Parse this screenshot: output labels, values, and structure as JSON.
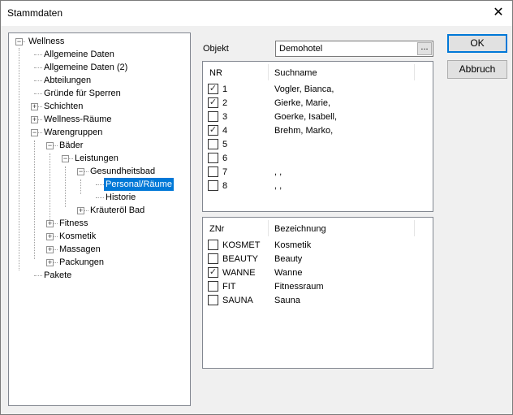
{
  "window": {
    "title": "Stammdaten",
    "close_glyph": "✕"
  },
  "tree": {
    "items": [
      {
        "label": "Wellness",
        "expander": "−"
      },
      {
        "label": "Allgemeine Daten"
      },
      {
        "label": "Allgemeine Daten (2)"
      },
      {
        "label": "Abteilungen"
      },
      {
        "label": "Gründe für Sperren"
      },
      {
        "label": "Schichten",
        "expander": "+"
      },
      {
        "label": "Wellness-Räume",
        "expander": "+"
      },
      {
        "label": "Warengruppen",
        "expander": "−"
      },
      {
        "label": "Bäder",
        "expander": "−"
      },
      {
        "label": "Leistungen",
        "expander": "−"
      },
      {
        "label": "Gesundheitsbad",
        "expander": "−"
      },
      {
        "label": "Personal/Räume",
        "selected": true
      },
      {
        "label": "Historie"
      },
      {
        "label": "Kräuteröl Bad",
        "expander": "+"
      },
      {
        "label": "Fitness",
        "expander": "+"
      },
      {
        "label": "Kosmetik",
        "expander": "+"
      },
      {
        "label": "Massagen",
        "expander": "+"
      },
      {
        "label": "Packungen",
        "expander": "+"
      },
      {
        "label": "Pakete"
      }
    ]
  },
  "object": {
    "label": "Objekt",
    "value": "Demohotel",
    "browse_label": "..."
  },
  "persons": {
    "columns": [
      "NR",
      "Suchname"
    ],
    "rows": [
      {
        "nr": "1",
        "name": "Vogler, Bianca,",
        "checked": true
      },
      {
        "nr": "2",
        "name": "Gierke, Marie,",
        "checked": true
      },
      {
        "nr": "3",
        "name": "Goerke, Isabell,",
        "checked": false
      },
      {
        "nr": "4",
        "name": "Brehm, Marko,",
        "checked": true
      },
      {
        "nr": "5",
        "name": "",
        "checked": false
      },
      {
        "nr": "6",
        "name": "",
        "checked": false
      },
      {
        "nr": "7",
        "name": ", ,",
        "checked": false
      },
      {
        "nr": "8",
        "name": ", ,",
        "checked": false
      }
    ]
  },
  "rooms": {
    "columns": [
      "ZNr",
      "Bezeichnung"
    ],
    "rows": [
      {
        "code": "KOSMET",
        "name": "Kosmetik",
        "checked": false
      },
      {
        "code": "BEAUTY",
        "name": "Beauty",
        "checked": false
      },
      {
        "code": "WANNE",
        "name": "Wanne",
        "checked": true
      },
      {
        "code": "FIT",
        "name": "Fitnessraum",
        "checked": false
      },
      {
        "code": "SAUNA",
        "name": "Sauna",
        "checked": false
      }
    ]
  },
  "buttons": {
    "ok": "OK",
    "cancel": "Abbruch"
  },
  "check_glyph": "✓"
}
